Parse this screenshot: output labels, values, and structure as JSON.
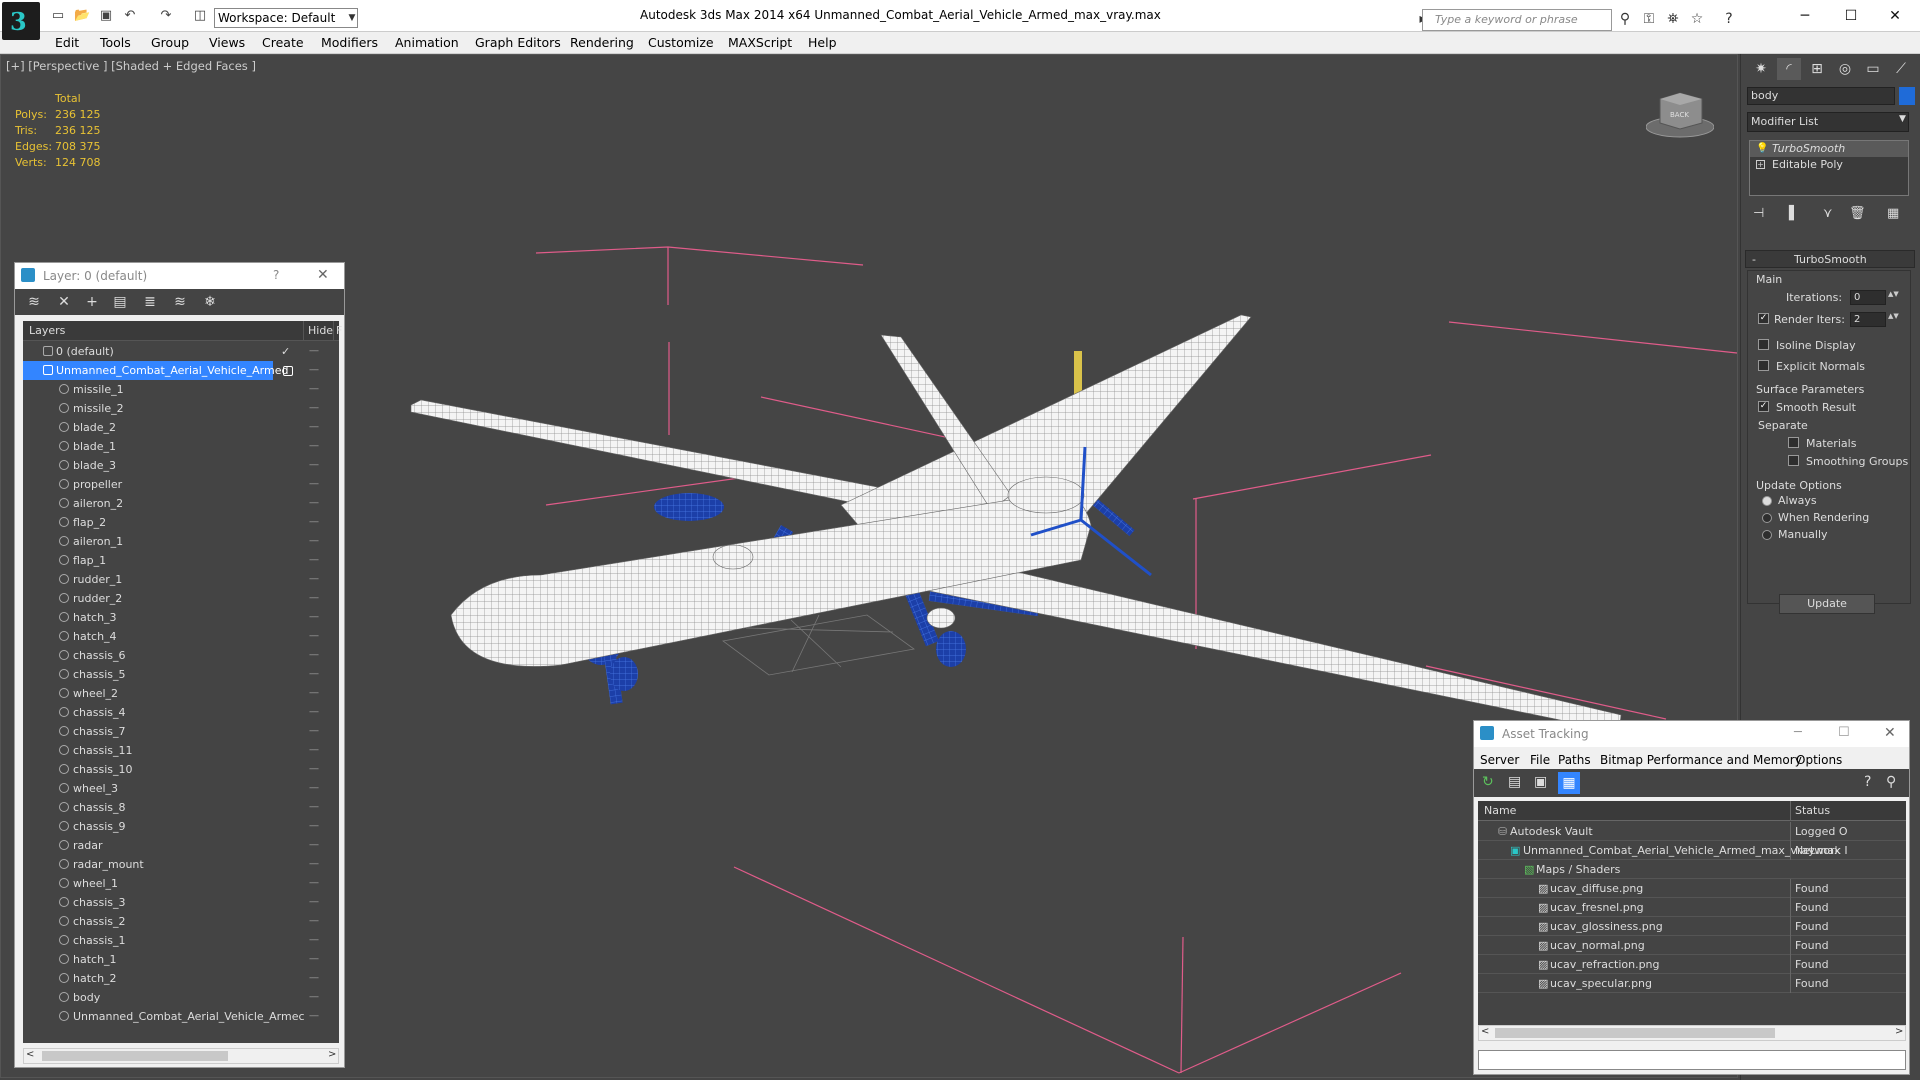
{
  "app": {
    "window_title": "Autodesk 3ds Max  2014 x64     Unmanned_Combat_Aerial_Vehicle_Armed_max_vray.max",
    "workspace": "Workspace: Default",
    "search_placeholder": "Type a keyword or phrase"
  },
  "menu": [
    "Edit",
    "Tools",
    "Group",
    "Views",
    "Create",
    "Modifiers",
    "Animation",
    "Graph Editors",
    "Rendering",
    "Customize",
    "MAXScript",
    "Help"
  ],
  "viewport": {
    "label": "[+] [Perspective ] [Shaded + Edged Faces ]",
    "stats": {
      "header": "Total",
      "rows": [
        {
          "label": "Polys:",
          "value": "236 125"
        },
        {
          "label": "Tris:",
          "value": "236 125"
        },
        {
          "label": "Edges:",
          "value": "708 375"
        },
        {
          "label": "Verts:",
          "value": "124 708"
        }
      ]
    },
    "viewcube_label": "BACK"
  },
  "layer_panel": {
    "title": "Layer: 0 (default)",
    "help": "?",
    "close": "✕",
    "col_layers": "Layers",
    "col_hide": "Hide",
    "col_extra": "F",
    "default_layer": "0 (default)",
    "selected_layer": "Unmanned_Combat_Aerial_Vehicle_Armed",
    "objects": [
      "missile_1",
      "missile_2",
      "blade_2",
      "blade_1",
      "blade_3",
      "propeller",
      "aileron_2",
      "flap_2",
      "aileron_1",
      "flap_1",
      "rudder_1",
      "rudder_2",
      "hatch_3",
      "hatch_4",
      "chassis_6",
      "chassis_5",
      "wheel_2",
      "chassis_4",
      "chassis_7",
      "chassis_11",
      "chassis_10",
      "wheel_3",
      "chassis_8",
      "chassis_9",
      "radar",
      "radar_mount",
      "wheel_1",
      "chassis_3",
      "chassis_2",
      "chassis_1",
      "hatch_1",
      "hatch_2",
      "body",
      "Unmanned_Combat_Aerial_Vehicle_Armec"
    ]
  },
  "command_panel": {
    "object_name": "body",
    "object_color": "#1f6bd8",
    "modifier_list": "Modifier List",
    "stack": [
      "TurboSmooth",
      "Editable Poly"
    ],
    "rollout_title": "TurboSmooth",
    "main_label": "Main",
    "iterations_label": "Iterations:",
    "iterations_value": "0",
    "render_iters_label": "Render Iters:",
    "render_iters_value": "2",
    "isoline": "Isoline Display",
    "explicit_normals": "Explicit Normals",
    "surface_params": "Surface Parameters",
    "smooth_result": "Smooth Result",
    "separate": "Separate",
    "materials": "Materials",
    "smoothing_groups": "Smoothing Groups",
    "update_options": "Update Options",
    "always": "Always",
    "when_rendering": "When Rendering",
    "manually": "Manually",
    "update_button": "Update"
  },
  "asset_tracking": {
    "title": "Asset Tracking",
    "menu": [
      "Server",
      "File",
      "Paths",
      "Bitmap Performance and Memory",
      "Options"
    ],
    "col_name": "Name",
    "col_status": "Status",
    "rows": [
      {
        "name": "Autodesk Vault",
        "status": "Logged O",
        "indent": 1
      },
      {
        "name": "Unmanned_Combat_Aerial_Vehicle_Armed_max_vray.max",
        "status": "Network I",
        "indent": 2
      },
      {
        "name": "Maps / Shaders",
        "status": "",
        "indent": 3
      },
      {
        "name": "ucav_diffuse.png",
        "status": "Found",
        "indent": 4
      },
      {
        "name": "ucav_fresnel.png",
        "status": "Found",
        "indent": 4
      },
      {
        "name": "ucav_glossiness.png",
        "status": "Found",
        "indent": 4
      },
      {
        "name": "ucav_normal.png",
        "status": "Found",
        "indent": 4
      },
      {
        "name": "ucav_refraction.png",
        "status": "Found",
        "indent": 4
      },
      {
        "name": "ucav_specular.png",
        "status": "Found",
        "indent": 4
      }
    ]
  },
  "colors": {
    "accent_blue": "#3385ff",
    "stats_yellow": "#e8c234",
    "bbox_pink": "#e05c8a",
    "model_blue": "#2050c8"
  }
}
